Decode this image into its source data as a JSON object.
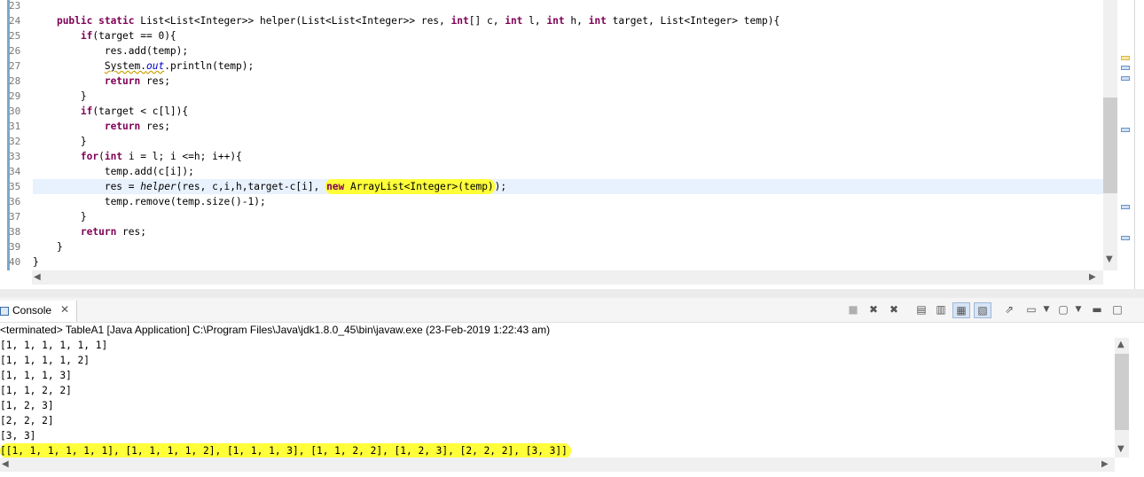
{
  "editor": {
    "line_numbers": [
      "23",
      "24",
      "25",
      "26",
      "27",
      "28",
      "29",
      "30",
      "31",
      "32",
      "33",
      "34",
      "35",
      "36",
      "37",
      "38",
      "39",
      "40"
    ]
  },
  "code": {
    "l24": {
      "indent": "    ",
      "kw1": "public static",
      "t1": " List<List<Integer>> helper(List<List<Integer>> ",
      "v_res": "res",
      "t2": ", ",
      "kw_int": "int",
      "t3": "[] ",
      "v_c": "c",
      "t4": ", ",
      "kw_int2": "int",
      "t5": " ",
      "v_l": "l",
      "t6": ", ",
      "kw_int3": "int",
      "t7": " ",
      "v_h": "h",
      "t8": ", ",
      "kw_int4": "int",
      "t9": " ",
      "v_target": "target",
      "t10": ", List<Integer> ",
      "v_temp": "temp",
      "t11": "){"
    },
    "l25": {
      "indent": "        ",
      "kw": "if",
      "t1": "(target == 0){"
    },
    "l26": {
      "indent": "            ",
      "t1": "res.add(temp);"
    },
    "l27": {
      "indent": "            ",
      "sys": "System.",
      "fld": "out",
      "t1": ".println(temp);"
    },
    "l28": {
      "indent": "            ",
      "kw": "return",
      "t1": " res;"
    },
    "l29": {
      "indent": "        ",
      "t1": "}"
    },
    "l30": {
      "indent": "        ",
      "kw": "if",
      "t1": "(target < c[l]){"
    },
    "l31": {
      "indent": "            ",
      "kw": "return",
      "t1": " res;"
    },
    "l32": {
      "indent": "        ",
      "t1": "}"
    },
    "l33": {
      "indent": "        ",
      "kw": "for",
      "t1": "(",
      "kw2": "int",
      "t2": " i = l; i <=h; i++){"
    },
    "l34": {
      "indent": "            ",
      "t1": "temp.add(c[i]);"
    },
    "l35": {
      "indent": "            ",
      "t1": "res = ",
      "call": "helper",
      "t2": "(res, c,i,h,target-c[i], ",
      "kw": "new",
      "t3": " ArrayList<Integer>(temp)",
      "t4": ");"
    },
    "l36": {
      "indent": "            ",
      "t1": "temp.remove(temp.size()-1);"
    },
    "l37": {
      "indent": "        ",
      "t1": "}"
    },
    "l38": {
      "indent": "        ",
      "kw": "return",
      "t1": " res;"
    },
    "l39": {
      "indent": "    ",
      "t1": "}"
    },
    "l40": {
      "t1": "}"
    }
  },
  "console": {
    "tab_label": "Console",
    "tab_close": "✕",
    "status": "<terminated> TableA1 [Java Application] C:\\Program Files\\Java\\jdk1.8.0_45\\bin\\javaw.exe (23-Feb-2019 1:22:43 am)",
    "output": [
      "[1, 1, 1, 1, 1, 1]",
      "[1, 1, 1, 1, 2]",
      "[1, 1, 1, 3]",
      "[1, 1, 2, 2]",
      "[1, 2, 3]",
      "[2, 2, 2]",
      "[3, 3]",
      "[[1, 1, 1, 1, 1, 1], [1, 1, 1, 1, 2], [1, 1, 1, 3], [1, 1, 2, 2], [1, 2, 3], [2, 2, 2], [3, 3]]"
    ],
    "toolbar_icons": [
      "terminate-icon",
      "remove-launch-icon",
      "remove-all-terminated-icon",
      "clear-console-icon",
      "scroll-lock-icon",
      "show-on-stdout-icon",
      "show-on-stderr-icon",
      "pin-console-icon",
      "display-selected-console-icon",
      "open-console-icon",
      "minimize-icon",
      "maximize-icon"
    ]
  },
  "colors": {
    "highlight": "#ffff3a",
    "keyword": "#7f0055",
    "field": "#0000c0",
    "current_line": "#e8f2fe"
  }
}
